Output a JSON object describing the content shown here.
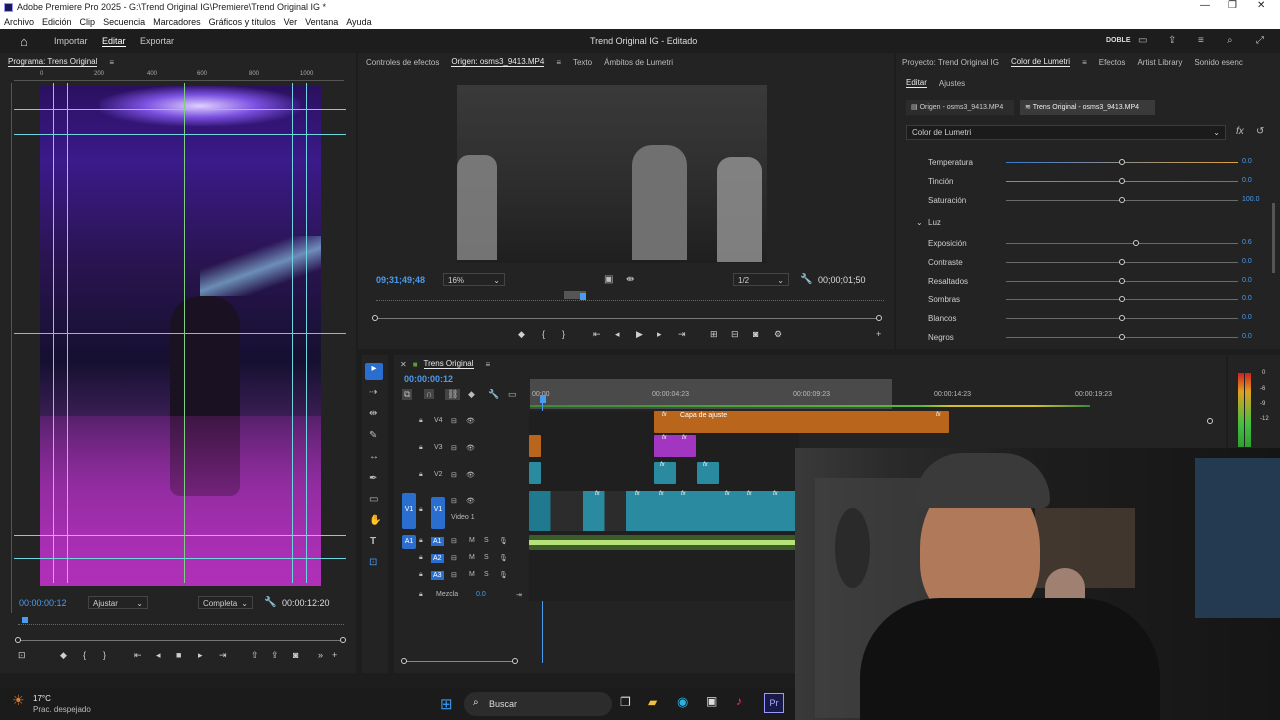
{
  "window": {
    "title": "Adobe Premiere Pro 2025 - G:\\Trend Original IG\\Premiere\\Trend Original IG *",
    "controls": [
      "—",
      "❐",
      "✕"
    ]
  },
  "menu": [
    "Archivo",
    "Edición",
    "Clip",
    "Secuencia",
    "Marcadores",
    "Gráficos y títulos",
    "Ver",
    "Ventana",
    "Ayuda"
  ],
  "appbar": {
    "tabs": [
      "Importar",
      "Editar",
      "Exportar"
    ],
    "active_tab": "Editar",
    "project_title": "Trend Original IG - Editado",
    "workspace": "DOBLE"
  },
  "program_monitor": {
    "title": "Programa: Trens Original",
    "ruler_ticks": [
      "0",
      "200",
      "400",
      "600",
      "800",
      "1000"
    ],
    "timecode": "00:00:00:12",
    "fit": "Ajustar",
    "quality": "Completa",
    "duration": "00:00:12:20",
    "left_ruler": [
      "0",
      "2",
      "0",
      "0",
      "4",
      "0",
      "0",
      "6",
      "0",
      "0",
      "8",
      "0",
      "0",
      "1",
      "0",
      "0",
      "0",
      "1",
      "2",
      "0",
      "0",
      "1",
      "4",
      "0",
      "0",
      "1",
      "6",
      "0",
      "0",
      "1",
      "8",
      "0",
      "0"
    ]
  },
  "source_monitor": {
    "tabs": [
      "Controles de efectos",
      "Origen: osms3_9413.MP4",
      "Texto",
      "Ámbitos de Lumetri"
    ],
    "active_tab": "Origen: osms3_9413.MP4",
    "timecode": "09;31;49;48",
    "zoom": "16%",
    "resolution": "1/2",
    "duration": "00;00;01;50"
  },
  "lumetri": {
    "tabs": [
      "Proyecto: Trend Original IG",
      "Color de Lumetri",
      "Efectos",
      "Artist Library",
      "Sonido esenc"
    ],
    "active_tab": "Color de Lumetri",
    "subtabs": [
      "Editar",
      "Ajustes"
    ],
    "source_chip": "Origen - osms3_9413.MP4",
    "seq_chip": "Trens Original - osms3_9413.MP4",
    "effect_name": "Color de Lumetri",
    "section": "Luz",
    "params": [
      {
        "label": "Temperatura",
        "value": "0.0",
        "pos": 0.5
      },
      {
        "label": "Tinción",
        "value": "0.0",
        "pos": 0.5
      },
      {
        "label": "Saturación",
        "value": "100.0",
        "pos": 0.5
      },
      {
        "label": "Exposición",
        "value": "0.6",
        "pos": 0.56
      },
      {
        "label": "Contraste",
        "value": "0.0",
        "pos": 0.5
      },
      {
        "label": "Resaltados",
        "value": "0.0",
        "pos": 0.5
      },
      {
        "label": "Sombras",
        "value": "0.0",
        "pos": 0.5
      },
      {
        "label": "Blancos",
        "value": "0.0",
        "pos": 0.5
      },
      {
        "label": "Negros",
        "value": "0.0",
        "pos": 0.5
      }
    ]
  },
  "timeline": {
    "sequence": "Trens Original",
    "timecode": "00:00:00:12",
    "ruler": [
      "00:00",
      "00:00:04:23",
      "00:00:09:23",
      "00:00:14:23",
      "00:00:19:23"
    ],
    "adjustment_clip": "Capa de ajuste",
    "video_tracks": [
      {
        "id": "V4"
      },
      {
        "id": "V3"
      },
      {
        "id": "V2"
      },
      {
        "id": "V1",
        "name": "Video 1",
        "source": "V1"
      }
    ],
    "audio_tracks": [
      {
        "id": "A1",
        "m": "M",
        "s": "S"
      },
      {
        "id": "A2",
        "m": "M",
        "s": "S"
      },
      {
        "id": "A3",
        "m": "M",
        "s": "S"
      }
    ],
    "mix_label": "Mezcla",
    "mix_value": "0.0",
    "meter_labels": [
      "0",
      "-6",
      "-12",
      "-9",
      "-12"
    ]
  },
  "taskbar": {
    "weather_temp": "17°C",
    "weather_desc": "Prac. despejado",
    "search": "Buscar"
  }
}
